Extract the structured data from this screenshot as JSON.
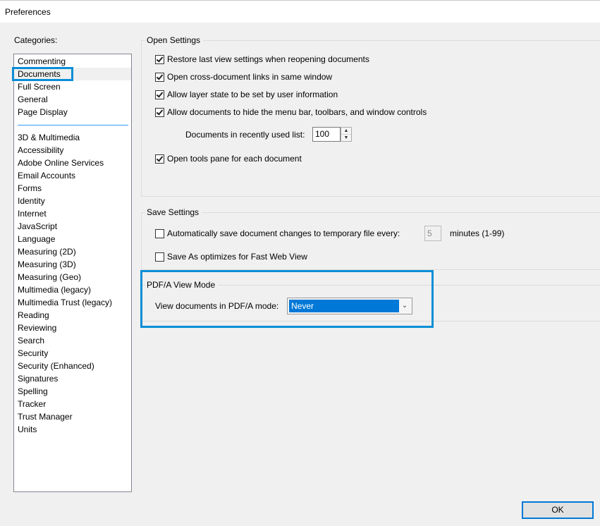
{
  "window": {
    "title": "Preferences"
  },
  "categories": {
    "label": "Categories:",
    "items_top": [
      "Commenting",
      "Documents",
      "Full Screen",
      "General",
      "Page Display"
    ],
    "items_bottom": [
      "3D & Multimedia",
      "Accessibility",
      "Adobe Online Services",
      "Email Accounts",
      "Forms",
      "Identity",
      "Internet",
      "JavaScript",
      "Language",
      "Measuring (2D)",
      "Measuring (3D)",
      "Measuring (Geo)",
      "Multimedia (legacy)",
      "Multimedia Trust (legacy)",
      "Reading",
      "Reviewing",
      "Search",
      "Security",
      "Security (Enhanced)",
      "Signatures",
      "Spelling",
      "Tracker",
      "Trust Manager",
      "Units"
    ],
    "selected": "Documents"
  },
  "open_settings": {
    "title": "Open Settings",
    "restore_view": {
      "label": "Restore last view settings when reopening documents",
      "checked": true
    },
    "cross_doc_links": {
      "label": "Open cross-document links in same window",
      "checked": true
    },
    "layer_state": {
      "label": "Allow layer state to be set by user information",
      "checked": true
    },
    "hide_menu": {
      "label": "Allow documents to hide the menu bar, toolbars, and window controls",
      "checked": true
    },
    "recent_list_label": "Documents in recently used list:",
    "recent_list_value": "100",
    "tools_pane": {
      "label": "Open tools pane for each document",
      "checked": true
    }
  },
  "save_settings": {
    "title": "Save Settings",
    "autosave": {
      "label": "Automatically save document changes to temporary file every:",
      "checked": false
    },
    "autosave_minutes": "5",
    "minutes_label": "minutes (1-99)",
    "fast_web": {
      "label": "Save As optimizes for Fast Web View",
      "checked": false
    }
  },
  "pdfa": {
    "title": "PDF/A View Mode",
    "mode_label": "View documents in PDF/A mode:",
    "mode_value": "Never"
  },
  "buttons": {
    "ok": "OK"
  },
  "colors": {
    "highlight": "#0a8fd6",
    "selection": "#0078d7",
    "separator": "#3399ff"
  }
}
